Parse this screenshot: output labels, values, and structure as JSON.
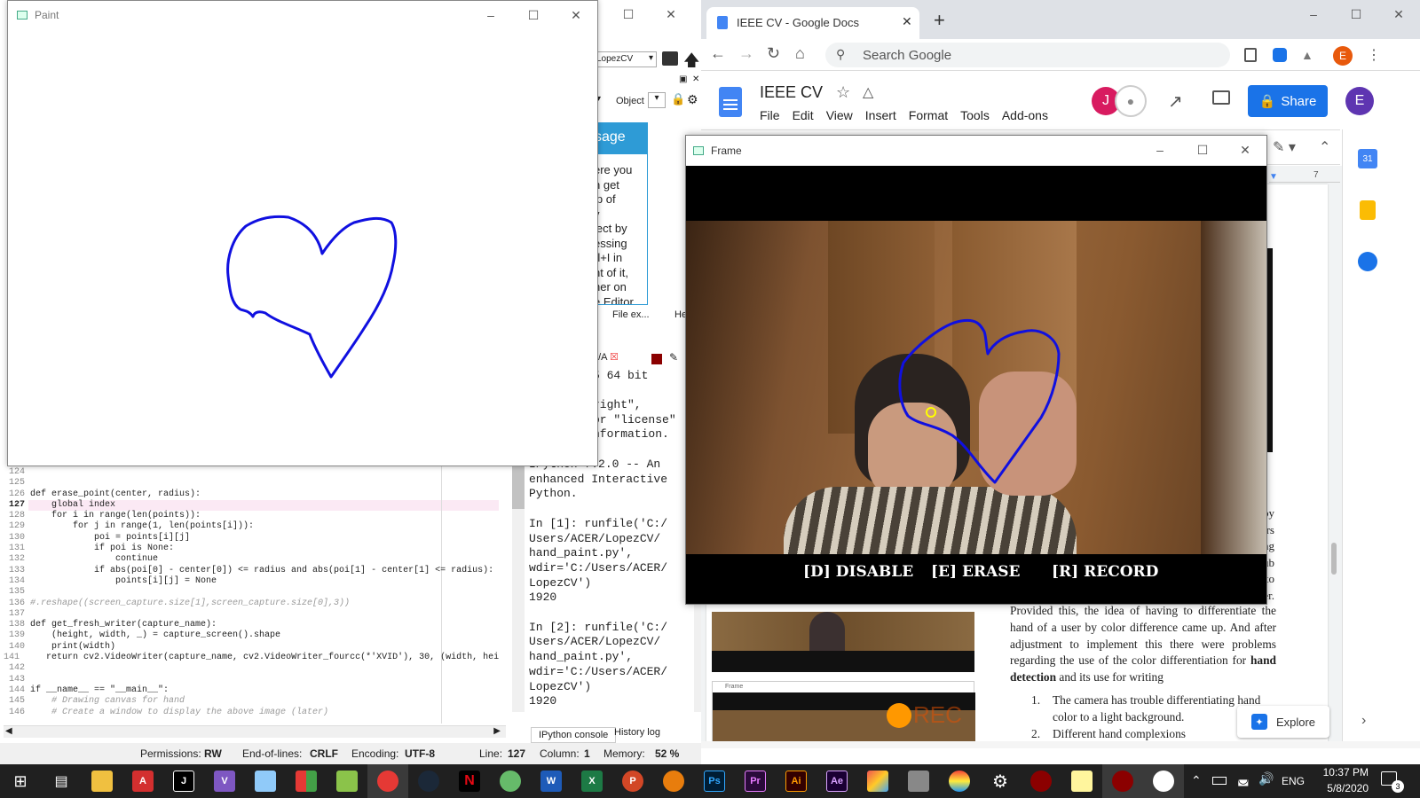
{
  "paint": {
    "title": "Paint"
  },
  "spyder": {
    "path": "LopezCV",
    "object_label": "Object",
    "help_title": "sage",
    "help_lines": [
      "ere you",
      "n get",
      "lp of",
      "y",
      "ject by",
      "essing",
      "rl+I in",
      "nt of it,",
      "her on",
      "e Editor"
    ],
    "help_tabs": [
      "File ex...",
      "He"
    ],
    "console_tab_partial": "1/A",
    "console_partial_lines": [
      "5 64 bit",
      "",
      "right\",",
      "or \"license\"",
      "nformation."
    ],
    "console_lines": [
      "IPython 7.2.0 -- An",
      "enhanced Interactive",
      "Python.",
      "",
      "In [1]: runfile('C:/",
      "Users/ACER/LopezCV/",
      "hand_paint.py',",
      "wdir='C:/Users/ACER/",
      "LopezCV')",
      "1920",
      "",
      "In [2]: runfile('C:/",
      "Users/ACER/LopezCV/",
      "hand_paint.py',",
      "wdir='C:/Users/ACER/",
      "LopezCV')",
      "1920"
    ],
    "console_tabs": [
      "IPython console",
      "History log"
    ],
    "code": [
      {
        "n": "124",
        "t": ""
      },
      {
        "n": "125",
        "t": ""
      },
      {
        "n": "126",
        "t": "def erase_point(center, radius):"
      },
      {
        "n": "127",
        "t": "    global index"
      },
      {
        "n": "128",
        "t": "    for i in range(len(points)):"
      },
      {
        "n": "129",
        "t": "        for j in range(1, len(points[i])):"
      },
      {
        "n": "130",
        "t": "            poi = points[i][j]"
      },
      {
        "n": "131",
        "t": "            if poi is None:"
      },
      {
        "n": "132",
        "t": "                continue"
      },
      {
        "n": "133",
        "t": "            if abs(poi[0] - center[0]) <= radius and abs(poi[1] - center[1] <= radius):"
      },
      {
        "n": "134",
        "t": "                points[i][j] = None"
      },
      {
        "n": "135",
        "t": ""
      },
      {
        "n": "136",
        "t": "#.reshape((screen_capture.size[1],screen_capture.size[0],3))"
      },
      {
        "n": "137",
        "t": ""
      },
      {
        "n": "138",
        "t": "def get_fresh_writer(capture_name):"
      },
      {
        "n": "139",
        "t": "    (height, width, _) = capture_screen().shape"
      },
      {
        "n": "140",
        "t": "    print(width)"
      },
      {
        "n": "141",
        "t": "    return cv2.VideoWriter(capture_name, cv2.VideoWriter_fourcc(*'XVID'), 30, (width, heig"
      },
      {
        "n": "142",
        "t": ""
      },
      {
        "n": "143",
        "t": ""
      },
      {
        "n": "144",
        "t": "if __name__ == \"__main__\":"
      },
      {
        "n": "145",
        "t": "    # Drawing canvas for hand"
      },
      {
        "n": "146",
        "t": "    # Create a window to display the above image (later)"
      }
    ],
    "status": {
      "permissions_label": "Permissions:",
      "permissions": "RW",
      "eol_label": "End-of-lines:",
      "eol": "CRLF",
      "encoding_label": "Encoding:",
      "encoding": "UTF-8",
      "line_label": "Line:",
      "line": "127",
      "column_label": "Column:",
      "column": "1",
      "memory_label": "Memory:",
      "memory": "52 %"
    }
  },
  "chrome": {
    "tab_title": "IEEE CV - Google Docs",
    "address": "Search Google",
    "docs": {
      "title": "IEEE CV",
      "menu": [
        "File",
        "Edit",
        "View",
        "Insert",
        "Format",
        "Tools",
        "Add-ons"
      ],
      "share": "Share",
      "avatar_j": "J",
      "avatar_e": "E",
      "calendar_day": "31",
      "ruler_num": "7",
      "right_partial": [
        "by",
        "ers",
        "ng",
        "ub",
        "to",
        "er."
      ],
      "para": [
        "Provided this, the idea of having to differentiate the",
        "hand of a user by color difference came up. And after",
        "adjustment to implement this there were problems",
        "regarding the use of the color differentiation for"
      ],
      "para_bold": "hand detection",
      "para_tail": " and its use for writing",
      "list": [
        {
          "num": "1.",
          "text": "The camera has trouble differentiating hand"
        },
        {
          "num": "",
          "text": "color to a light background."
        },
        {
          "num": "2.",
          "text": "Different hand complexions"
        }
      ],
      "thumb2_title": "Frame",
      "thumb2_rec": "REC",
      "explore": "Explore"
    }
  },
  "frame": {
    "title": "Frame",
    "labels": [
      "[D] DISABLE",
      "[E] ERASE",
      "[R] RECORD"
    ]
  },
  "taskbar": {
    "time": "10:37 PM",
    "date": "5/8/2020",
    "lang": "ENG",
    "notif_count": "3"
  }
}
